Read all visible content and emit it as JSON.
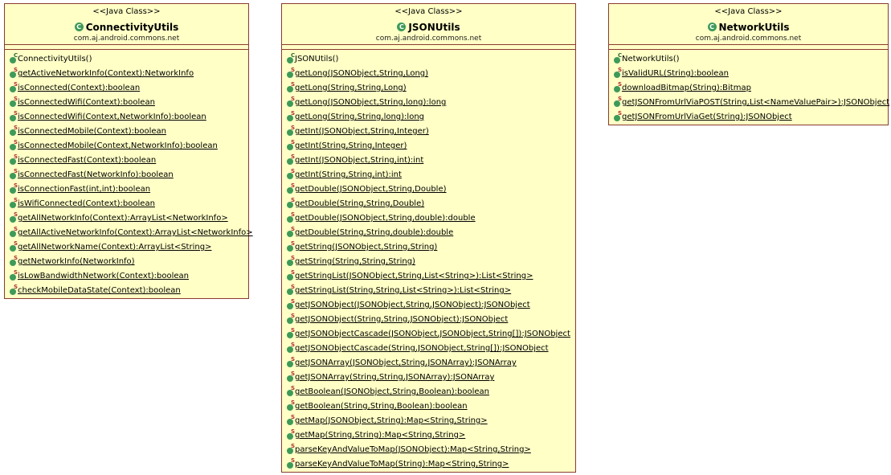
{
  "classes": [
    {
      "stereotype": "<<Java Class>>",
      "name": "ConnectivityUtils",
      "package": "com.aj.android.commons.net",
      "icon": "class-icon",
      "methods": [
        {
          "label": "ConnectivityUtils()",
          "modifier": "C"
        },
        {
          "label": "getActiveNetworkInfo(Context):NetworkInfo",
          "modifier": "S"
        },
        {
          "label": "isConnected(Context):boolean",
          "modifier": "S"
        },
        {
          "label": "isConnectedWifi(Context):boolean",
          "modifier": "S"
        },
        {
          "label": "isConnectedWifi(Context,NetworkInfo):boolean",
          "modifier": "S"
        },
        {
          "label": "isConnectedMobile(Context):boolean",
          "modifier": "S"
        },
        {
          "label": "isConnectedMobile(Context,NetworkInfo):boolean",
          "modifier": "S"
        },
        {
          "label": "isConnectedFast(Context):boolean",
          "modifier": "S"
        },
        {
          "label": "isConnectedFast(NetworkInfo):boolean",
          "modifier": "S"
        },
        {
          "label": "isConnectionFast(int,int):boolean",
          "modifier": "S"
        },
        {
          "label": "isWifiConnected(Context):boolean",
          "modifier": "S"
        },
        {
          "label": "getAllNetworkInfo(Context):ArrayList<NetworkInfo>",
          "modifier": "S"
        },
        {
          "label": "getAllActiveNetworkInfo(Context):ArrayList<NetworkInfo>",
          "modifier": "S"
        },
        {
          "label": "getAllNetworkName(Context):ArrayList<String>",
          "modifier": "S"
        },
        {
          "label": "getNetworkInfo(NetworkInfo)",
          "modifier": "S"
        },
        {
          "label": "isLowBandwidthNetwork(Context):boolean",
          "modifier": "S"
        },
        {
          "label": "checkMobileDataState(Context):boolean",
          "modifier": "S"
        }
      ]
    },
    {
      "stereotype": "<<Java Class>>",
      "name": "JSONUtils",
      "package": "com.aj.android.commons.net",
      "icon": "class-icon",
      "methods": [
        {
          "label": "JSONUtils()",
          "modifier": "C"
        },
        {
          "label": "getLong(JSONObject,String,Long)",
          "modifier": "S"
        },
        {
          "label": "getLong(String,String,Long)",
          "modifier": "S"
        },
        {
          "label": "getLong(JSONObject,String,long):long",
          "modifier": "S"
        },
        {
          "label": "getLong(String,String,long):long",
          "modifier": "S"
        },
        {
          "label": "getInt(JSONObject,String,Integer)",
          "modifier": "S"
        },
        {
          "label": "getInt(String,String,Integer)",
          "modifier": "S"
        },
        {
          "label": "getInt(JSONObject,String,int):int",
          "modifier": "S"
        },
        {
          "label": "getInt(String,String,int):int",
          "modifier": "S"
        },
        {
          "label": "getDouble(JSONObject,String,Double)",
          "modifier": "S"
        },
        {
          "label": "getDouble(String,String,Double)",
          "modifier": "S"
        },
        {
          "label": "getDouble(JSONObject,String,double):double",
          "modifier": "S"
        },
        {
          "label": "getDouble(String,String,double):double",
          "modifier": "S"
        },
        {
          "label": "getString(JSONObject,String,String)",
          "modifier": "S"
        },
        {
          "label": "getString(String,String,String)",
          "modifier": "S"
        },
        {
          "label": "getStringList(JSONObject,String,List<String>):List<String>",
          "modifier": "S"
        },
        {
          "label": "getStringList(String,String,List<String>):List<String>",
          "modifier": "S"
        },
        {
          "label": "getJSONObject(JSONObject,String,JSONObject):JSONObject",
          "modifier": "S"
        },
        {
          "label": "getJSONObject(String,String,JSONObject):JSONObject",
          "modifier": "S"
        },
        {
          "label": "getJSONObjectCascade(JSONObject,JSONObject,String[]):JSONObject",
          "modifier": "S"
        },
        {
          "label": "getJSONObjectCascade(String,JSONObject,String[]):JSONObject",
          "modifier": "S"
        },
        {
          "label": "getJSONArray(JSONObject,String,JSONArray):JSONArray",
          "modifier": "S"
        },
        {
          "label": "getJSONArray(String,String,JSONArray):JSONArray",
          "modifier": "S"
        },
        {
          "label": "getBoolean(JSONObject,String,Boolean):boolean",
          "modifier": "S"
        },
        {
          "label": "getBoolean(String,String,Boolean):boolean",
          "modifier": "S"
        },
        {
          "label": "getMap(JSONObject,String):Map<String,String>",
          "modifier": "S"
        },
        {
          "label": "getMap(String,String):Map<String,String>",
          "modifier": "S"
        },
        {
          "label": "parseKeyAndValueToMap(JSONObject):Map<String,String>",
          "modifier": "S"
        },
        {
          "label": "parseKeyAndValueToMap(String):Map<String,String>",
          "modifier": "S"
        }
      ]
    },
    {
      "stereotype": "<<Java Class>>",
      "name": "NetworkUtils",
      "package": "com.aj.android.commons.net",
      "icon": "class-icon",
      "methods": [
        {
          "label": "NetworkUtils()",
          "modifier": "C"
        },
        {
          "label": "isValidURL(String):boolean",
          "modifier": "S"
        },
        {
          "label": "downloadBitmap(String):Bitmap",
          "modifier": "S"
        },
        {
          "label": "getJSONFromUrlViaPOST(String,List<NameValuePair>):JSONObject",
          "modifier": "S"
        },
        {
          "label": "getJSONFromUrlViaGet(String):JSONObject",
          "modifier": "S"
        }
      ]
    }
  ],
  "colors": {
    "box_fill": "#ffffc6",
    "box_border": "#8a3a30",
    "method_icon": "#3f9a5a",
    "static_marker": "#b23030"
  }
}
